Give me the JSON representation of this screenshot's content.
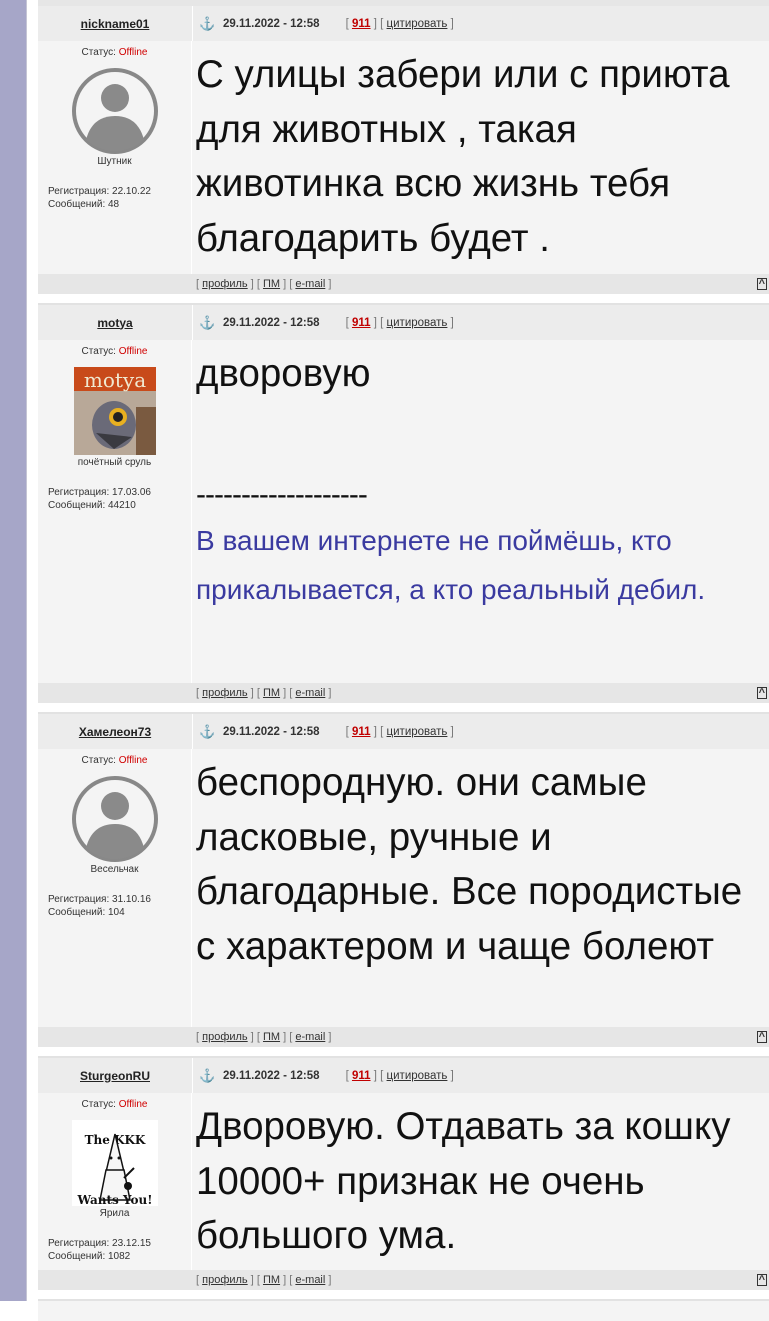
{
  "labels": {
    "status_prefix": "Статус: ",
    "reg_prefix": "Регистрация: ",
    "msgs_prefix": "Сообщений: ",
    "profile": "профиль",
    "pm": "ПМ",
    "email": "e-mail",
    "quote": "цитировать",
    "up": "^",
    "post_num": "911"
  },
  "posts": [
    {
      "nick": "nickname01",
      "status": "Offline",
      "rank": "Шутник",
      "registered": "22.10.22",
      "messages": "48",
      "date": "29.11.2022 - 12:58",
      "text": "С улицы забери или с приюта для животных , такая животинка всю жизнь тебя благодарить будет ."
    },
    {
      "nick": "motya",
      "status": "Offline",
      "rank": "почётный сруль",
      "registered": "17.03.06",
      "messages": "44210",
      "date": "29.11.2022 - 12:58",
      "text": "дворовую",
      "sig_line": "-------------------",
      "signature": "В вашем интернете не поймёшь, кто прикалывается, а кто реальный дебил.",
      "avatar_text": "motya"
    },
    {
      "nick": "Хамелеон73",
      "status": "Offline",
      "rank": "Весельчак",
      "registered": "31.10.16",
      "messages": "104",
      "date": "29.11.2022 - 12:58",
      "text": "беспородную. они самые ласковые, ручные и благодарные. Все породистые с характером и чаще болеют"
    },
    {
      "nick": "SturgeonRU",
      "status": "Offline",
      "rank": "Ярила",
      "registered": "23.12.15",
      "messages": "1082",
      "date": "29.11.2022 - 12:58",
      "text": "Дворовую. Отдавать за кошку 10000+ признак не очень большого ума.",
      "avatar_top": "The KKK",
      "avatar_bottom": "Wants You!"
    }
  ],
  "colors": {
    "left_bar": "#a6a6c8",
    "offline": "#d00000",
    "post_num": "#c00000",
    "signature": "#3a3aa0"
  }
}
